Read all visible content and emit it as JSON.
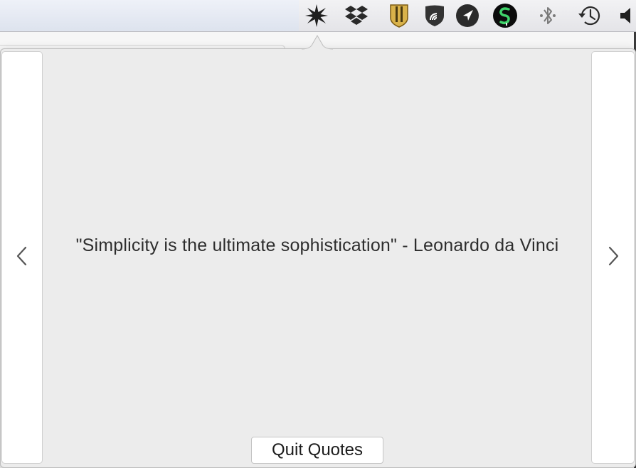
{
  "menubar": {
    "status_icons": [
      "starburst-icon",
      "dropbox-icon",
      "shield-stripes-icon",
      "wifi-shield-icon",
      "location-arrow-icon",
      "dollar-circle-icon",
      "bluetooth-icon",
      "time-machine-icon",
      "volume-icon"
    ]
  },
  "popover": {
    "quote": "\"Simplicity is the ultimate sophistication\" - Leonardo da Vinci",
    "quit_label": "Quit Quotes",
    "prev_icon": "chevron-left-icon",
    "next_icon": "chevron-right-icon"
  }
}
